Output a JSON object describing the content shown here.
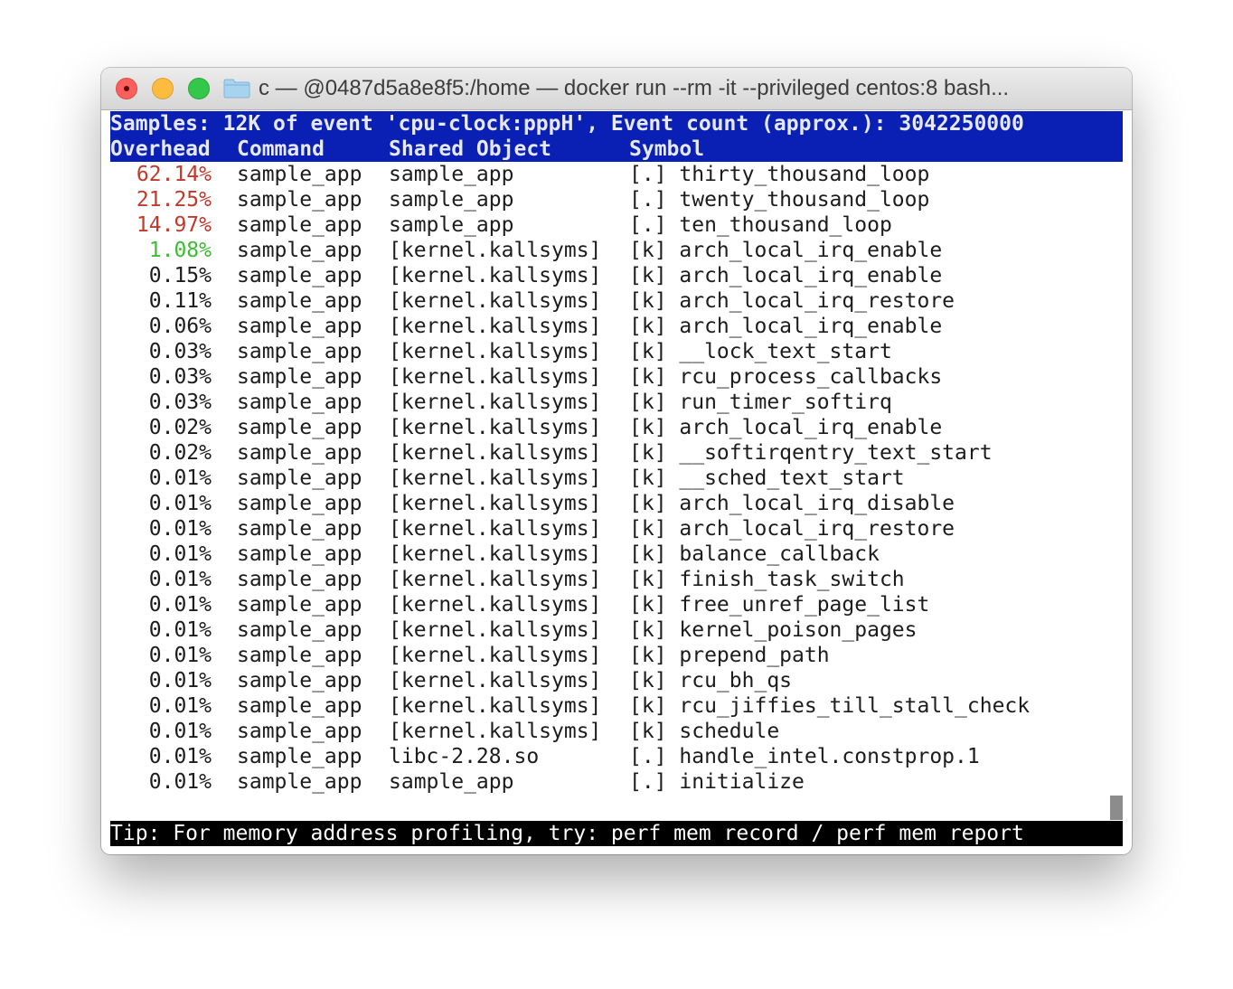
{
  "window": {
    "title": "c — @0487d5a8e8f5:/home — docker run --rm -it --privileged centos:8 bash..."
  },
  "perf": {
    "samples_line": "Samples: 12K of event 'cpu-clock:pppH', Event count (approx.): 3042250000",
    "headers": {
      "overhead": "Overhead",
      "command": "Command",
      "shared_object": "Shared Object",
      "symbol": "Symbol"
    },
    "rows": [
      {
        "overhead": "62.14%",
        "command": "sample_app",
        "shared_object": "sample_app",
        "symbol": "[.] thirty_thousand_loop",
        "color": "red"
      },
      {
        "overhead": "21.25%",
        "command": "sample_app",
        "shared_object": "sample_app",
        "symbol": "[.] twenty_thousand_loop",
        "color": "red"
      },
      {
        "overhead": "14.97%",
        "command": "sample_app",
        "shared_object": "sample_app",
        "symbol": "[.] ten_thousand_loop",
        "color": "red"
      },
      {
        "overhead": "1.08%",
        "command": "sample_app",
        "shared_object": "[kernel.kallsyms]",
        "symbol": "[k] arch_local_irq_enable",
        "color": "green"
      },
      {
        "overhead": "0.15%",
        "command": "sample_app",
        "shared_object": "[kernel.kallsyms]",
        "symbol": "[k] arch_local_irq_enable",
        "color": "normal"
      },
      {
        "overhead": "0.11%",
        "command": "sample_app",
        "shared_object": "[kernel.kallsyms]",
        "symbol": "[k] arch_local_irq_restore",
        "color": "normal"
      },
      {
        "overhead": "0.06%",
        "command": "sample_app",
        "shared_object": "[kernel.kallsyms]",
        "symbol": "[k] arch_local_irq_enable",
        "color": "normal"
      },
      {
        "overhead": "0.03%",
        "command": "sample_app",
        "shared_object": "[kernel.kallsyms]",
        "symbol": "[k] __lock_text_start",
        "color": "normal"
      },
      {
        "overhead": "0.03%",
        "command": "sample_app",
        "shared_object": "[kernel.kallsyms]",
        "symbol": "[k] rcu_process_callbacks",
        "color": "normal"
      },
      {
        "overhead": "0.03%",
        "command": "sample_app",
        "shared_object": "[kernel.kallsyms]",
        "symbol": "[k] run_timer_softirq",
        "color": "normal"
      },
      {
        "overhead": "0.02%",
        "command": "sample_app",
        "shared_object": "[kernel.kallsyms]",
        "symbol": "[k] arch_local_irq_enable",
        "color": "normal"
      },
      {
        "overhead": "0.02%",
        "command": "sample_app",
        "shared_object": "[kernel.kallsyms]",
        "symbol": "[k] __softirqentry_text_start",
        "color": "normal"
      },
      {
        "overhead": "0.01%",
        "command": "sample_app",
        "shared_object": "[kernel.kallsyms]",
        "symbol": "[k] __sched_text_start",
        "color": "normal"
      },
      {
        "overhead": "0.01%",
        "command": "sample_app",
        "shared_object": "[kernel.kallsyms]",
        "symbol": "[k] arch_local_irq_disable",
        "color": "normal"
      },
      {
        "overhead": "0.01%",
        "command": "sample_app",
        "shared_object": "[kernel.kallsyms]",
        "symbol": "[k] arch_local_irq_restore",
        "color": "normal"
      },
      {
        "overhead": "0.01%",
        "command": "sample_app",
        "shared_object": "[kernel.kallsyms]",
        "symbol": "[k] balance_callback",
        "color": "normal"
      },
      {
        "overhead": "0.01%",
        "command": "sample_app",
        "shared_object": "[kernel.kallsyms]",
        "symbol": "[k] finish_task_switch",
        "color": "normal"
      },
      {
        "overhead": "0.01%",
        "command": "sample_app",
        "shared_object": "[kernel.kallsyms]",
        "symbol": "[k] free_unref_page_list",
        "color": "normal"
      },
      {
        "overhead": "0.01%",
        "command": "sample_app",
        "shared_object": "[kernel.kallsyms]",
        "symbol": "[k] kernel_poison_pages",
        "color": "normal"
      },
      {
        "overhead": "0.01%",
        "command": "sample_app",
        "shared_object": "[kernel.kallsyms]",
        "symbol": "[k] prepend_path",
        "color": "normal"
      },
      {
        "overhead": "0.01%",
        "command": "sample_app",
        "shared_object": "[kernel.kallsyms]",
        "symbol": "[k] rcu_bh_qs",
        "color": "normal"
      },
      {
        "overhead": "0.01%",
        "command": "sample_app",
        "shared_object": "[kernel.kallsyms]",
        "symbol": "[k] rcu_jiffies_till_stall_check",
        "color": "normal"
      },
      {
        "overhead": "0.01%",
        "command": "sample_app",
        "shared_object": "[kernel.kallsyms]",
        "symbol": "[k] schedule",
        "color": "normal"
      },
      {
        "overhead": "0.01%",
        "command": "sample_app",
        "shared_object": "libc-2.28.so",
        "symbol": "[.] handle_intel.constprop.1",
        "color": "normal"
      },
      {
        "overhead": "0.01%",
        "command": "sample_app",
        "shared_object": "sample_app",
        "symbol": "[.] initialize",
        "color": "normal"
      }
    ],
    "tip": "Tip: For memory address profiling, try: perf mem record / perf mem report"
  },
  "colors": {
    "header_bg": "#0a1fb3",
    "high_overhead": "#c0392b",
    "medium_overhead": "#3cbc32"
  },
  "icons": {
    "close": "close-button",
    "minimize": "minimize-button",
    "maximize": "zoom-button",
    "folder": "folder-icon"
  }
}
